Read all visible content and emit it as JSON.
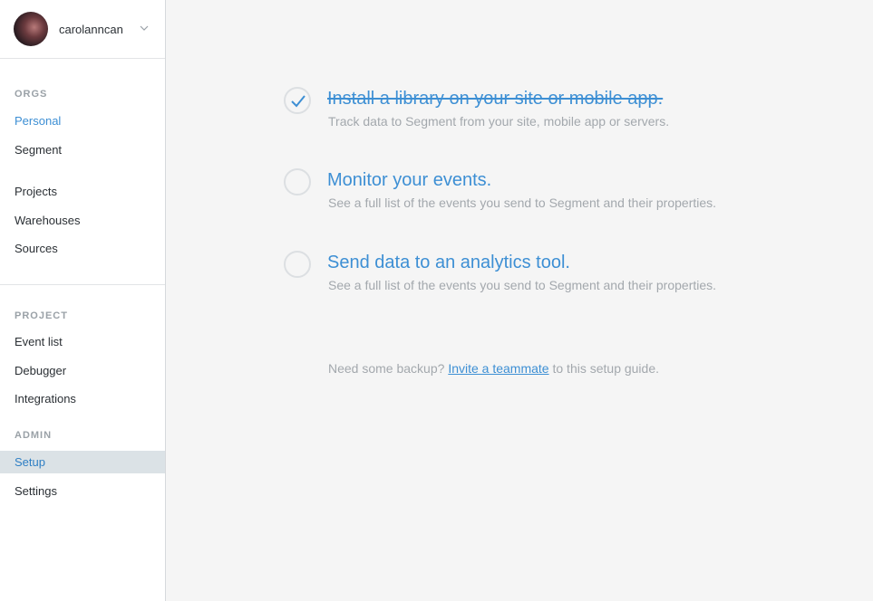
{
  "user": {
    "name": "carolanncan"
  },
  "sidebar": {
    "orgs_label": "ORGS",
    "orgs": [
      "Personal",
      "Segment"
    ],
    "workspace": [
      "Projects",
      "Warehouses",
      "Sources"
    ],
    "project_label": "PROJECT",
    "project": [
      "Event list",
      "Debugger",
      "Integrations"
    ],
    "admin_label": "ADMIN",
    "admin": [
      "Setup",
      "Settings"
    ]
  },
  "steps": [
    {
      "title": "Install a library on your site or mobile app.",
      "description": "Track data to Segment from your site, mobile app or servers.",
      "done": true
    },
    {
      "title": "Monitor your events.",
      "description": "See a full list of the events you send to Segment and their properties.",
      "done": false
    },
    {
      "title": "Send data to an analytics tool.",
      "description": "See a full list of the events you send to Segment and their properties.",
      "done": false
    }
  ],
  "help": {
    "prefix": "Need some backup?",
    "link": "Invite a teammate",
    "suffix": "to this setup guide."
  },
  "colors": {
    "accent": "#3d8fd4",
    "selected_bg": "#dbe2e6",
    "muted": "#a3a8ad"
  },
  "icons": {
    "user_menu": "chevron-down-icon",
    "completed_step": "check-icon"
  }
}
